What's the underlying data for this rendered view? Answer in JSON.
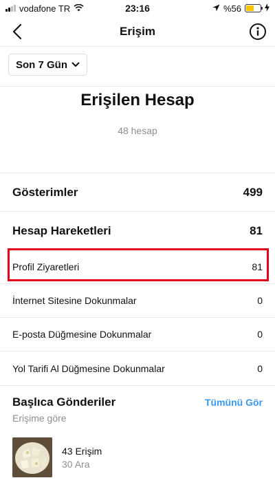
{
  "status_bar": {
    "carrier": "vodafone TR",
    "time": "23:16",
    "battery_percent": "%56",
    "battery_level": 0.56,
    "battery_color": "#f6c400"
  },
  "nav": {
    "title": "Erişim",
    "back_icon": "chevron-left-icon",
    "info_icon": "info-circle-icon"
  },
  "filter": {
    "label": "Son 7 Gün"
  },
  "reach": {
    "title": "Erişilen Hesap",
    "subtitle": "48 hesap"
  },
  "metrics": {
    "impressions": {
      "label": "Gösterimler",
      "value": "499"
    },
    "account_actions": {
      "label": "Hesap Hareketleri",
      "value": "81"
    },
    "rows": [
      {
        "label": "Profil Ziyaretleri",
        "value": "81"
      },
      {
        "label": "İnternet Sitesine Dokunmalar",
        "value": "0"
      },
      {
        "label": "E-posta Düğmesine Dokunmalar",
        "value": "0"
      },
      {
        "label": "Yol Tarifi Al Düğmesine Dokunmalar",
        "value": "0"
      }
    ],
    "highlight_color": "#e3001b"
  },
  "top_posts": {
    "title": "Başlıca Gönderiler",
    "see_all": "Tümünü Gör",
    "subtitle": "Erişime göre",
    "accent_color": "#3897f0",
    "items": [
      {
        "stat": "43 Erişim",
        "time": "30 Ara"
      }
    ]
  }
}
